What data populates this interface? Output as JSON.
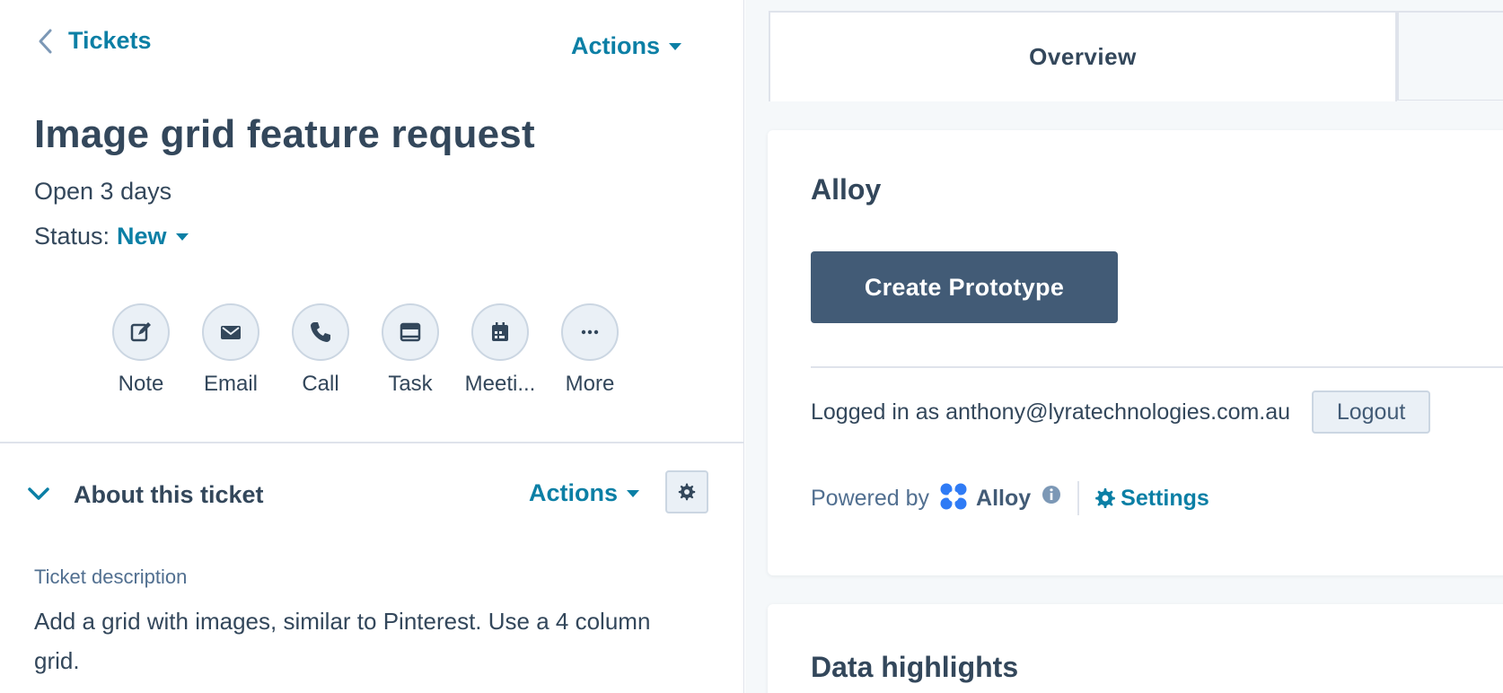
{
  "colors": {
    "link": "#0b7fa5",
    "text": "#33475b",
    "primary_button": "#425b76",
    "background": "#f5f8fa"
  },
  "header": {
    "back_label": "Tickets",
    "actions_label": "Actions"
  },
  "ticket": {
    "title": "Image grid feature request",
    "open_duration": "Open 3 days",
    "status_label": "Status:",
    "status_value": "New"
  },
  "activities": [
    {
      "label": "Note",
      "icon": "note-icon"
    },
    {
      "label": "Email",
      "icon": "email-icon"
    },
    {
      "label": "Call",
      "icon": "phone-icon"
    },
    {
      "label": "Task",
      "icon": "task-icon"
    },
    {
      "label": "Meeti...",
      "icon": "calendar-icon"
    },
    {
      "label": "More",
      "icon": "ellipsis-icon"
    }
  ],
  "about": {
    "title": "About this ticket",
    "actions_label": "Actions",
    "description_label": "Ticket description",
    "description": "Add a grid with images, similar to Pinterest. Use a 4 column grid."
  },
  "tabs": {
    "overview": "Overview"
  },
  "alloy_card": {
    "title": "Alloy",
    "create_button": "Create Prototype",
    "logged_in_text": "Logged in as anthony@lyratechnologies.com.au",
    "logout_button": "Logout",
    "powered_by": "Powered by",
    "brand": "Alloy",
    "settings_link": "Settings"
  },
  "data_card": {
    "title": "Data highlights"
  }
}
